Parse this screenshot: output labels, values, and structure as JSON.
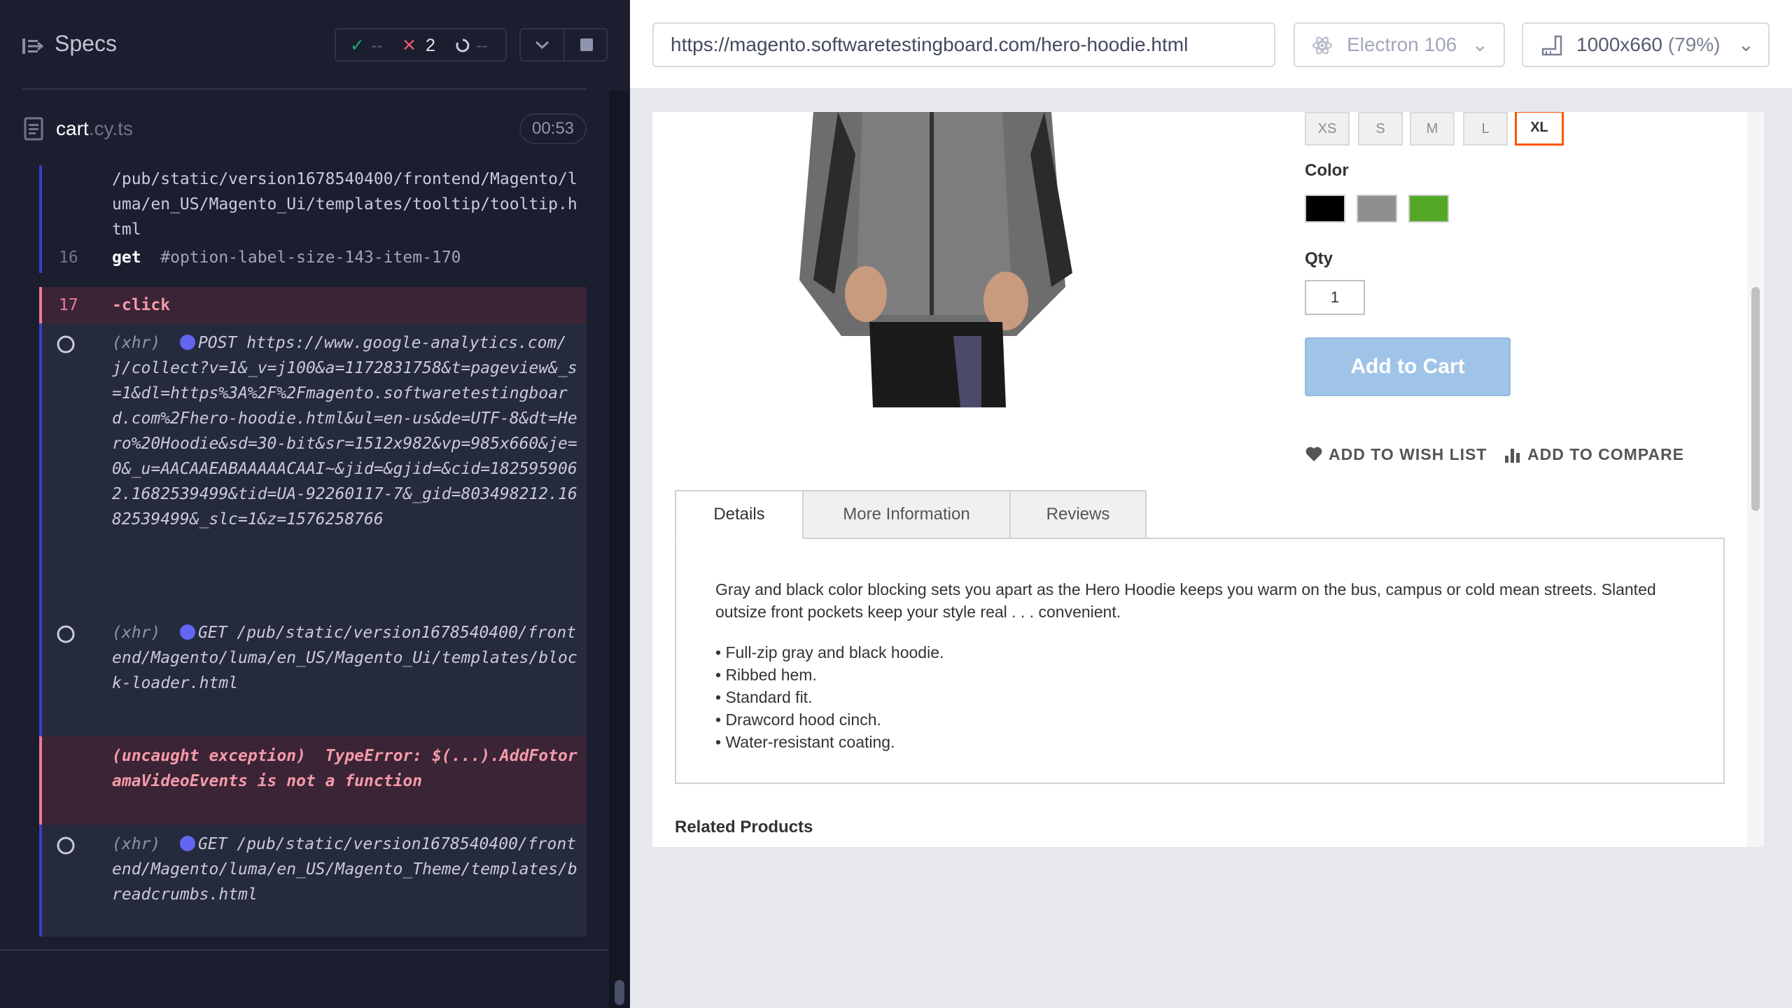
{
  "runner": {
    "title": "Specs",
    "stats": {
      "passed": "--",
      "failed": "2",
      "pending": "--"
    },
    "spec": {
      "name": "cart",
      "ext": ".cy.ts",
      "timer": "00:53"
    },
    "log": {
      "tooltip_path": "/pub/static/version1678540400/frontend/Magento/luma/en_US/Magento_Ui/templates/tooltip/tooltip.html",
      "get_num": "16",
      "get_cmd": "get",
      "get_sel": "#option-label-size-143-item-170",
      "click_num": "17",
      "click_cmd": "-click",
      "xhr_label": "(xhr)",
      "xhr1_method": "POST",
      "xhr1_url": "https://www.google-analytics.com/j/collect?v=1&_v=j100&a=1172831758&t=pageview&_s=1&dl=https%3A%2F%2Fmagento.softwaretestingboard.com%2Fhero-hoodie.html&ul=en-us&de=UTF-8&dt=Hero%20Hoodie&sd=30-bit&sr=1512x982&vp=985x660&je=0&_u=AACAAEABAAAAACAAI~&jid=&gjid=&cid=1825959062.1682539499&tid=UA-92260117-7&_gid=803498212.1682539499&_slc=1&z=1576258766",
      "xhr2_method": "GET",
      "xhr2_url": "/pub/static/version1678540400/frontend/Magento/luma/en_US/Magento_Ui/templates/block-loader.html",
      "exception": "(uncaught exception)  TypeError: $(...).AddFotoramaVideoEvents is not a function",
      "xhr3_method": "GET",
      "xhr3_url": "/pub/static/version1678540400/frontend/Magento/luma/en_US/Magento_Theme/templates/breadcrumbs.html"
    }
  },
  "aut": {
    "url": "https://magento.softwaretestingboard.com/hero-hoodie.html",
    "browser": "Electron 106",
    "viewport": "1000x660",
    "viewport_pct": "(79%)"
  },
  "product": {
    "sizes": [
      "XS",
      "S",
      "M",
      "L",
      "XL"
    ],
    "selected_size": "XL",
    "color_label": "Color",
    "colors": [
      "#000000",
      "#8f8f8f",
      "#53a828"
    ],
    "qty_label": "Qty",
    "qty": "1",
    "add_to_cart": "Add to Cart",
    "wish": "ADD TO WISH LIST",
    "compare": "ADD TO COMPARE",
    "tabs": [
      "Details",
      "More Information",
      "Reviews"
    ],
    "description": "Gray and black color blocking sets you apart as the Hero Hoodie keeps you warm on the bus, campus or cold mean streets. Slanted outsize front pockets keep your style real . . . convenient.",
    "bullets": [
      "• Full-zip gray and black hoodie.",
      "• Ribbed hem.",
      "• Standard fit.",
      "• Drawcord hood cinch.",
      "• Water-resistant coating."
    ],
    "related": "Related Products"
  }
}
